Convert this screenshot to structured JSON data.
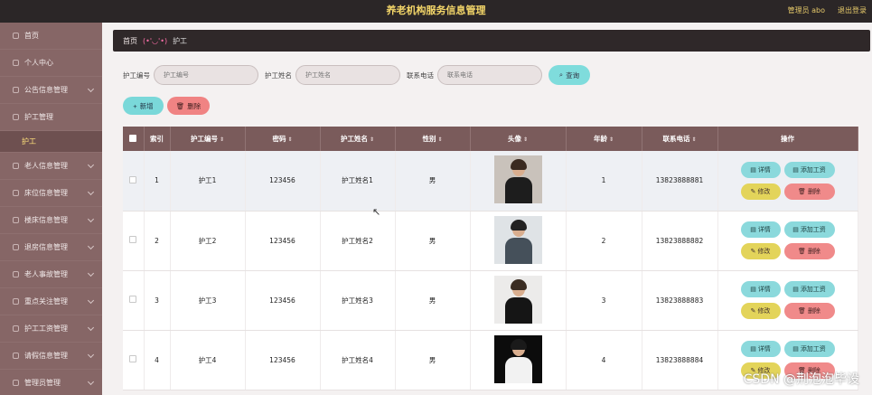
{
  "header": {
    "title": "养老机构服务信息管理",
    "admin": "管理员 abo",
    "logout": "退出登录"
  },
  "sidebar": {
    "items": [
      {
        "label": "首页",
        "expand": false
      },
      {
        "label": "个人中心",
        "expand": false
      },
      {
        "label": "公告信息管理",
        "expand": true
      },
      {
        "label": "护工管理",
        "expand": false
      },
      {
        "label": "护工",
        "sub": true
      },
      {
        "label": "老人信息管理",
        "expand": true
      },
      {
        "label": "床位信息管理",
        "expand": true
      },
      {
        "label": "楼床信息管理",
        "expand": true
      },
      {
        "label": "退房信息管理",
        "expand": true
      },
      {
        "label": "老人事故管理",
        "expand": true
      },
      {
        "label": "重点关注管理",
        "expand": true
      },
      {
        "label": "护工工资管理",
        "expand": true
      },
      {
        "label": "请假信息管理",
        "expand": true
      },
      {
        "label": "管理员管理",
        "expand": true
      }
    ]
  },
  "breadcrumb": {
    "home": "首页",
    "face": "(•'◡'•)",
    "current": "护工"
  },
  "search": {
    "fields": [
      {
        "label": "护工编号",
        "placeholder": "护工编号"
      },
      {
        "label": "护工姓名",
        "placeholder": "护工姓名"
      },
      {
        "label": "联系电话",
        "placeholder": "联系电话"
      }
    ],
    "query_label": "查询"
  },
  "actions": {
    "add_label": "新增",
    "delete_label": "删除"
  },
  "table": {
    "headers": [
      "索引",
      "护工编号",
      "密码",
      "护工姓名",
      "性别",
      "头像",
      "年龄",
      "联系电话",
      "操作"
    ],
    "rows": [
      {
        "index": "1",
        "code": "护工1",
        "password": "123456",
        "name": "护工姓名1",
        "gender": "男",
        "age": "1",
        "phone": "13823888881",
        "avatar": {
          "bg": "#c9c2bb",
          "hair": "#3a2a20",
          "body": "#1d1d1d"
        }
      },
      {
        "index": "2",
        "code": "护工2",
        "password": "123456",
        "name": "护工姓名2",
        "gender": "男",
        "age": "2",
        "phone": "13823888882",
        "avatar": {
          "bg": "#dfe3e6",
          "hair": "#222",
          "body": "#45505a"
        }
      },
      {
        "index": "3",
        "code": "护工3",
        "password": "123456",
        "name": "护工姓名3",
        "gender": "男",
        "age": "3",
        "phone": "13823888883",
        "avatar": {
          "bg": "#ecebea",
          "hair": "#3a2c22",
          "body": "#151515"
        }
      },
      {
        "index": "4",
        "code": "护工4",
        "password": "123456",
        "name": "护工姓名4",
        "gender": "男",
        "age": "4",
        "phone": "13823888884",
        "avatar": {
          "bg": "#0c0c0c",
          "hair": "#1a1a1a",
          "body": "#f2f2f2"
        }
      }
    ],
    "row_actions": {
      "detail": "详情",
      "add_salary": "添加工资",
      "edit": "修改",
      "remove": "删除"
    }
  },
  "watermark": "CSDN @荆泡泡毕设"
}
